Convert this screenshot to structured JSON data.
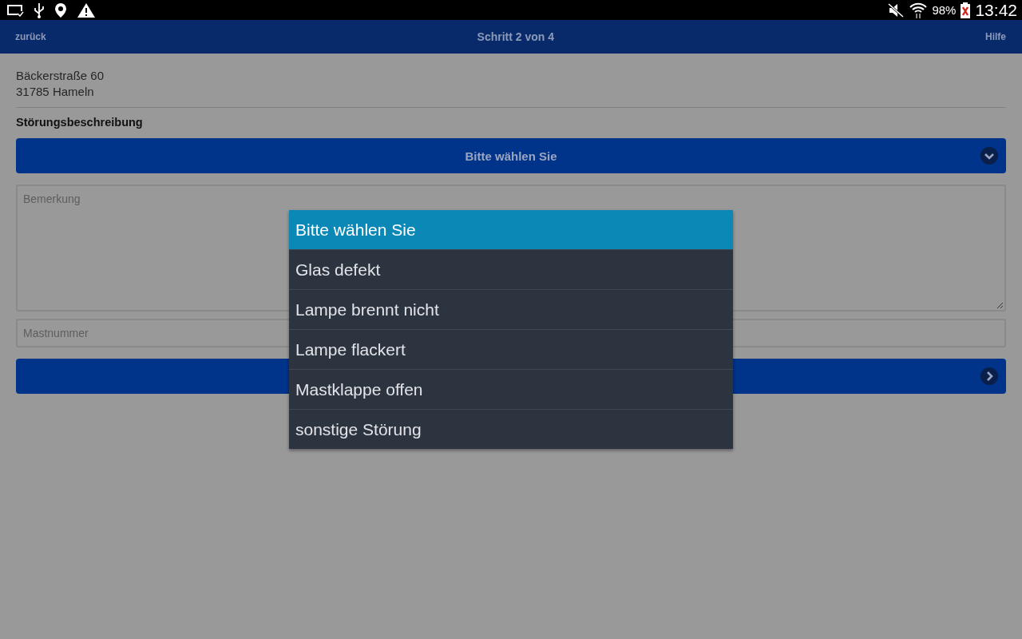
{
  "status_bar": {
    "battery": "98%",
    "time": "13:42"
  },
  "header": {
    "back": "zurück",
    "title": "Schritt 2 von 4",
    "help": "Hilfe"
  },
  "address": [
    "Bäckerstraße 60",
    "31785 Hameln"
  ],
  "section_label": "Störungsbeschreibung",
  "select": {
    "value": "Bitte wählen Sie"
  },
  "remark_field": {
    "placeholder": "Bemerkung"
  },
  "mast_field": {
    "placeholder": "Mastnummer"
  },
  "dropdown": {
    "options": [
      {
        "label": "Bitte wählen Sie",
        "selected": true
      },
      {
        "label": "Glas defekt",
        "selected": false
      },
      {
        "label": "Lampe brennt nicht",
        "selected": false
      },
      {
        "label": "Lampe flackert",
        "selected": false
      },
      {
        "label": "Mastklappe offen",
        "selected": false
      },
      {
        "label": "sonstige Störung",
        "selected": false
      }
    ]
  }
}
